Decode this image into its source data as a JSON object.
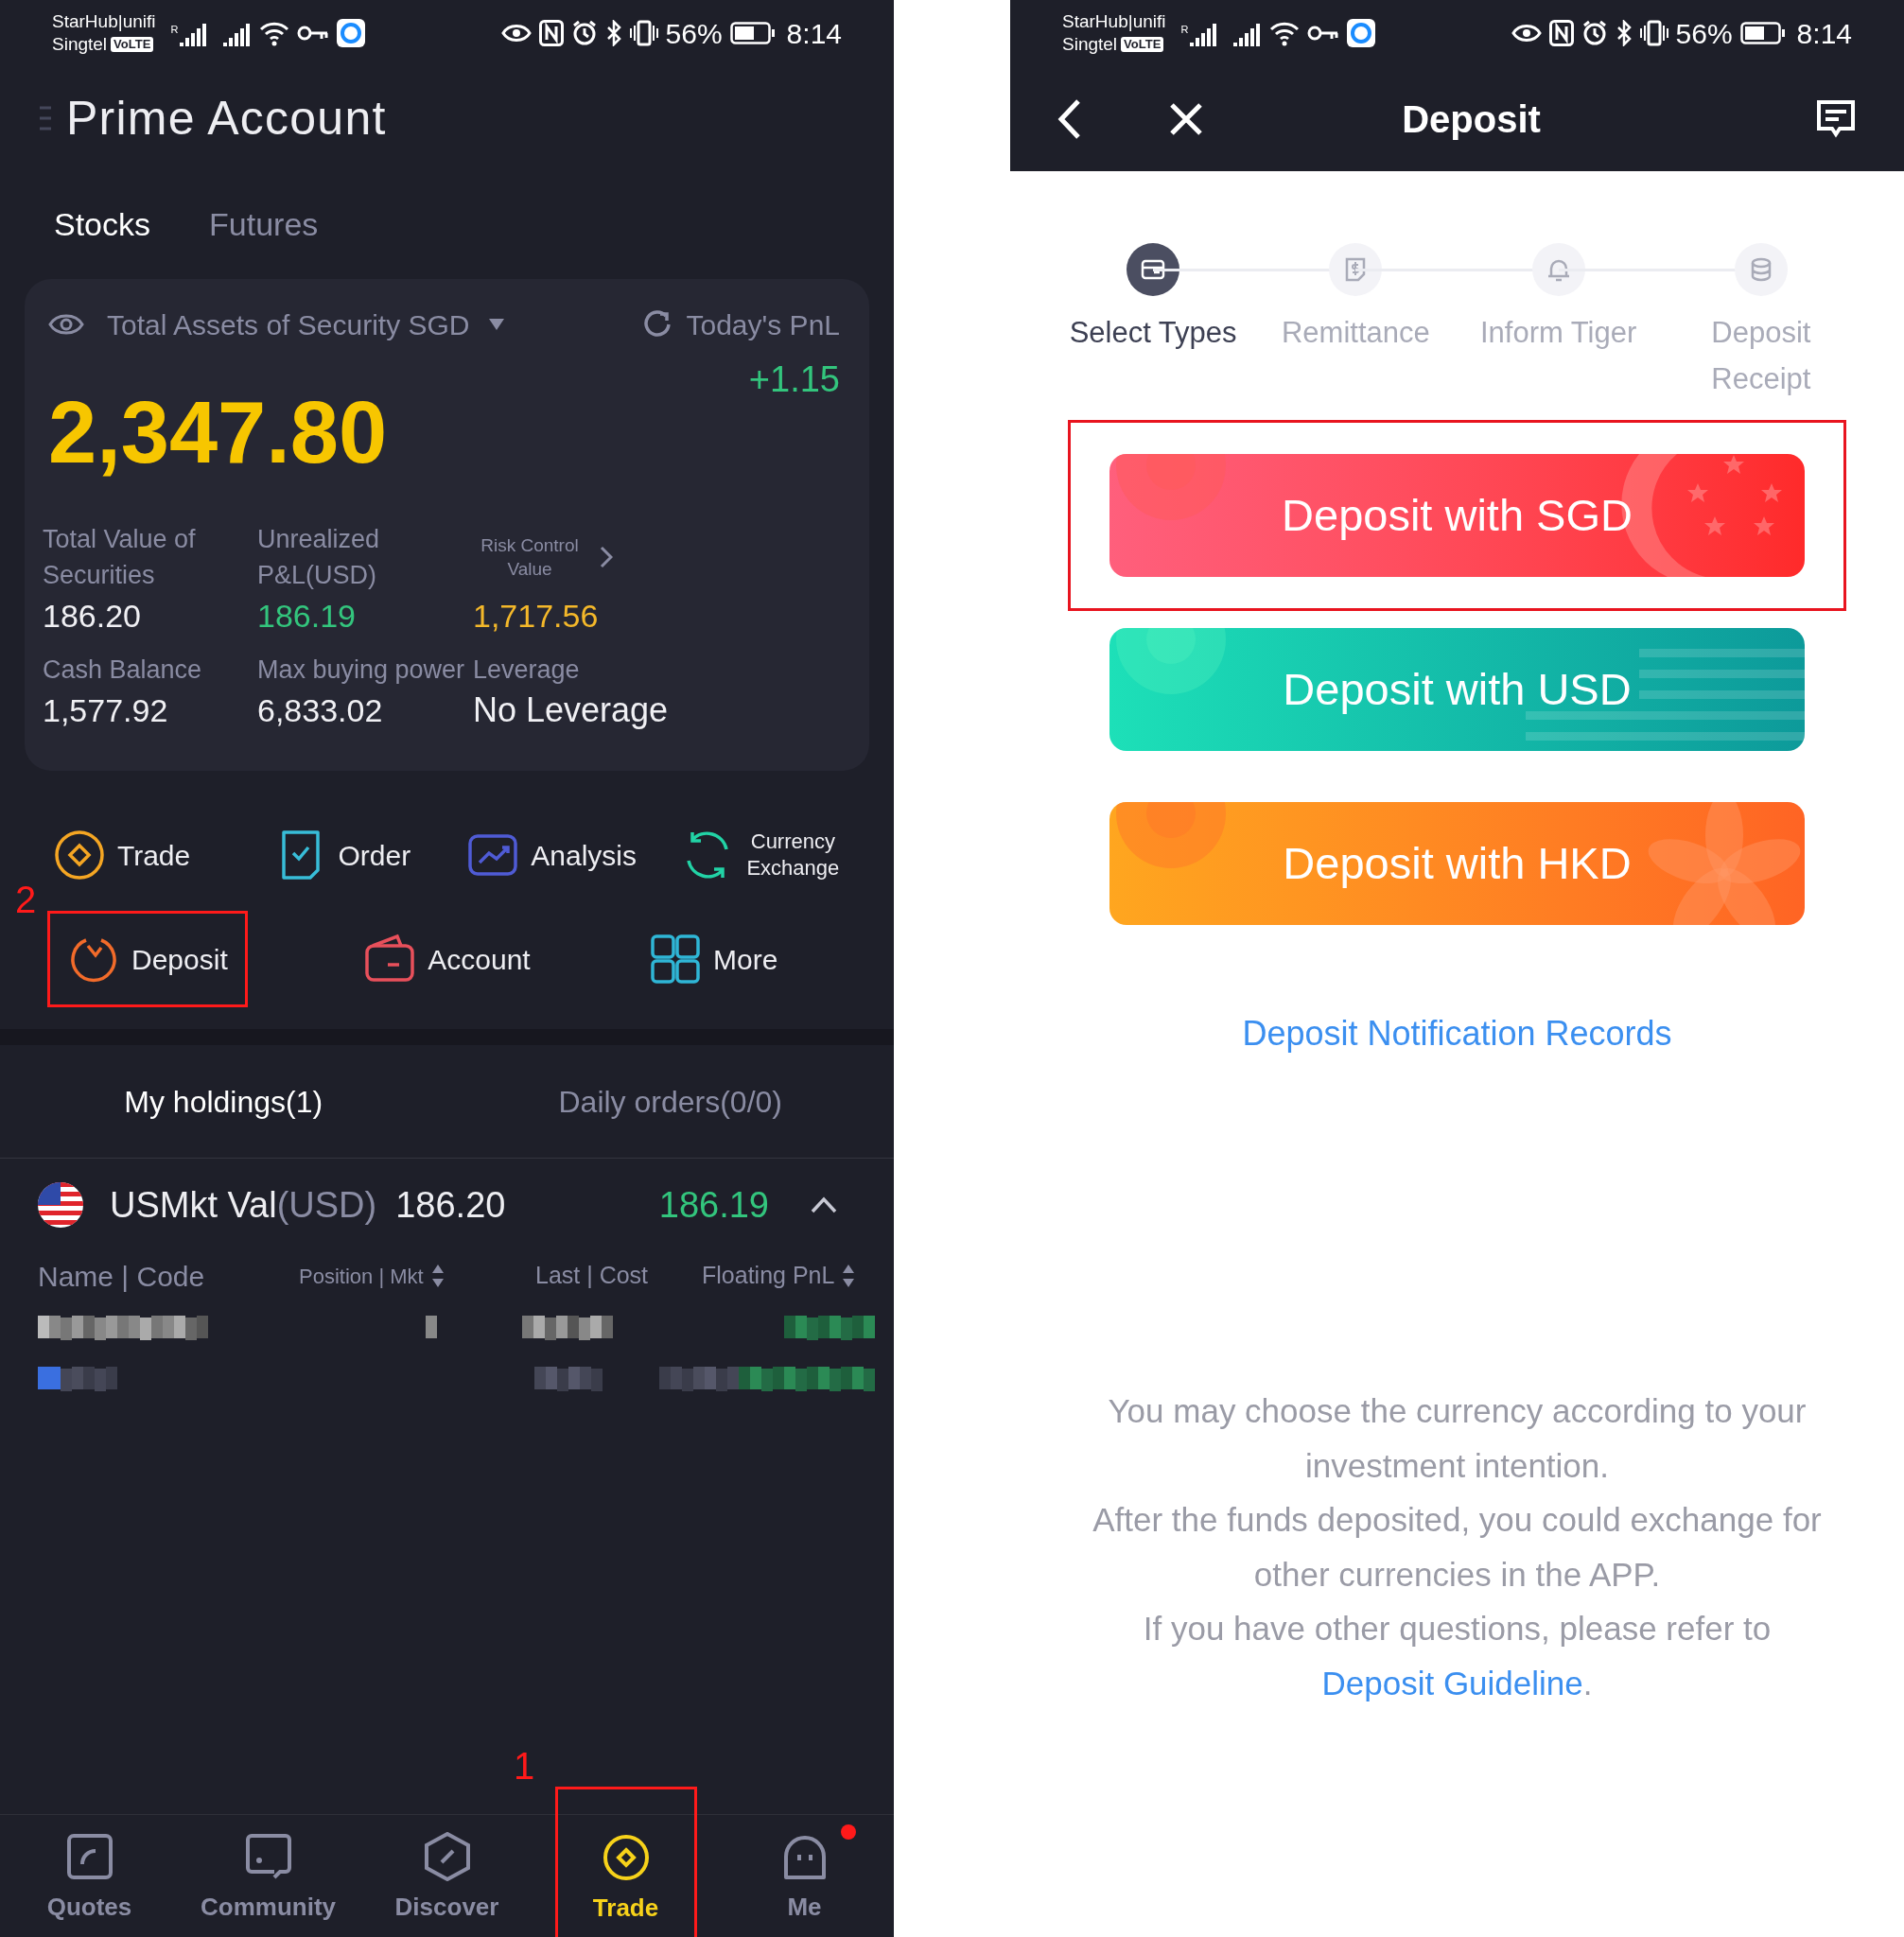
{
  "left_screen": {
    "status_bar": {
      "carriers": [
        "StarHub|unifi",
        "Singtel"
      ],
      "network_badge": "VoLTE",
      "roaming_mark": "R",
      "battery": "56%",
      "time": "8:14"
    },
    "title": "Prime Account",
    "tabs": [
      {
        "label": "Stocks",
        "selected": true
      },
      {
        "label": "Futures",
        "selected": false
      }
    ],
    "summary": {
      "assets_label": "Total Assets of Security SGD",
      "pnl_label": "Today's PnL",
      "total": "2,347.80",
      "pnl_value": "+1.15",
      "stats": [
        {
          "label": "Total Value of Securities",
          "value": "186.20",
          "color": "#f0f0f4",
          "kind": "plain"
        },
        {
          "label": "Unrealized P&L(USD)",
          "value": "186.19",
          "color": "#33c57d",
          "kind": "plain"
        },
        {
          "label": "Risk Control Value",
          "value": "1,717.56",
          "color": "#f4b82a",
          "kind": "link"
        },
        {
          "label": "Cash Balance",
          "value": "1,577.92",
          "color": "#f0f0f4",
          "kind": "plain"
        },
        {
          "label": "Max buying power",
          "value": "6,833.02",
          "color": "#f0f0f4",
          "kind": "plain"
        },
        {
          "label": "Leverage",
          "value": "No Leverage",
          "color": "#f0f0f4",
          "kind": "plain"
        }
      ]
    },
    "quick_actions": [
      [
        {
          "label": "Trade",
          "kind": "trade",
          "highlighted": false
        },
        {
          "label": "Order",
          "kind": "order",
          "highlighted": false
        },
        {
          "label": "Analysis",
          "kind": "analysis",
          "highlighted": false
        },
        {
          "label": "Currency Exchange",
          "kind": "exchange",
          "highlighted": false
        }
      ],
      [
        {
          "label": "Deposit",
          "kind": "deposit",
          "highlighted": true,
          "annotation": "2"
        },
        {
          "label": "Account",
          "kind": "account",
          "highlighted": false
        },
        {
          "label": "More",
          "kind": "more",
          "highlighted": false
        }
      ]
    ],
    "holdings": {
      "tabs": [
        {
          "label": "My holdings(1)",
          "selected": true
        },
        {
          "label": "Daily orders(0/0)",
          "selected": false
        }
      ],
      "market": {
        "name": "USMkt Val",
        "currency": "(USD)",
        "value": "186.20",
        "pnl": "186.19",
        "expanded": true
      },
      "columns": [
        {
          "label": "Name | Code",
          "sortable": false
        },
        {
          "label": "Position | Mkt",
          "sortable": true
        },
        {
          "label": "Last | Cost",
          "sortable": false
        },
        {
          "label": "Floating PnL",
          "sortable": true
        }
      ]
    },
    "nav": [
      {
        "label": "Quotes",
        "kind": "quotes",
        "selected": false,
        "highlighted": false,
        "dot": false
      },
      {
        "label": "Community",
        "kind": "community",
        "selected": false,
        "highlighted": false,
        "dot": false
      },
      {
        "label": "Discover",
        "kind": "discover",
        "selected": false,
        "highlighted": false,
        "dot": false
      },
      {
        "label": "Trade",
        "kind": "trade",
        "selected": true,
        "highlighted": true,
        "dot": false,
        "annotation": "1"
      },
      {
        "label": "Me",
        "kind": "me",
        "selected": false,
        "highlighted": false,
        "dot": true
      }
    ]
  },
  "right_screen": {
    "status_bar": {
      "carriers": [
        "StarHub|unifi",
        "Singtel"
      ],
      "network_badge": "VoLTE",
      "roaming_mark": "R",
      "battery": "56%",
      "time": "8:14"
    },
    "title": "Deposit",
    "steps": [
      {
        "label": "Select Types",
        "kind": "card",
        "selected": true
      },
      {
        "label": "Remittance",
        "kind": "bill",
        "selected": false
      },
      {
        "label": "Inform Tiger",
        "kind": "bell",
        "selected": false
      },
      {
        "label": "Deposit Receipt",
        "kind": "coins",
        "selected": false
      }
    ],
    "options": [
      {
        "label": "Deposit with SGD",
        "kind": "sgd",
        "highlighted": true
      },
      {
        "label": "Deposit with USD",
        "kind": "usd",
        "highlighted": false
      },
      {
        "label": "Deposit with HKD",
        "kind": "hkd",
        "highlighted": false
      }
    ],
    "records_link": "Deposit Notification Records",
    "notes": [
      {
        "text": "You may choose the currency according to your investment intention."
      },
      {
        "text": "After the funds deposited, you could exchange for other currencies in the APP."
      },
      {
        "text": "If you have other questions, please refer to ",
        "link": "Deposit Guideline",
        "after": "."
      }
    ]
  }
}
